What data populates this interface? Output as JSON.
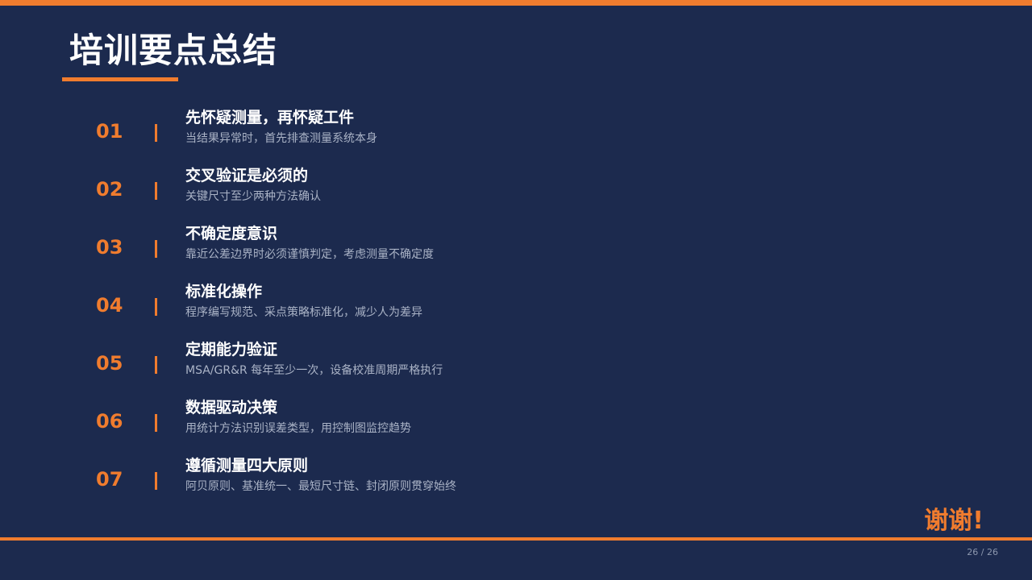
{
  "slide": {
    "title": "培训要点总结",
    "points": [
      {
        "number": "01",
        "heading": "先怀疑测量，再怀疑工件",
        "description": "当结果异常时，首先排查测量系统本身"
      },
      {
        "number": "02",
        "heading": "交叉验证是必须的",
        "description": "关键尺寸至少两种方法确认"
      },
      {
        "number": "03",
        "heading": "不确定度意识",
        "description": "靠近公差边界时必须谨慎判定，考虑测量不确定度"
      },
      {
        "number": "04",
        "heading": "标准化操作",
        "description": "程序编写规范、采点策略标准化，减少人为差异"
      },
      {
        "number": "05",
        "heading": "定期能力验证",
        "description": "MSA/GR&R 每年至少一次，设备校准周期严格执行"
      },
      {
        "number": "06",
        "heading": "数据驱动决策",
        "description": "用统计方法识别误差类型，用控制图监控趋势"
      },
      {
        "number": "07",
        "heading": "遵循测量四大原则",
        "description": "阿贝原则、基准统一、最短尺寸链、封闭原则贯穿始终"
      }
    ],
    "thanks": "谢谢!",
    "page_number": "26 / 26"
  },
  "colors": {
    "background": "#1c2a4e",
    "accent": "#f07c2e",
    "heading_text": "#ffffff",
    "description_text": "#aab3c6"
  }
}
